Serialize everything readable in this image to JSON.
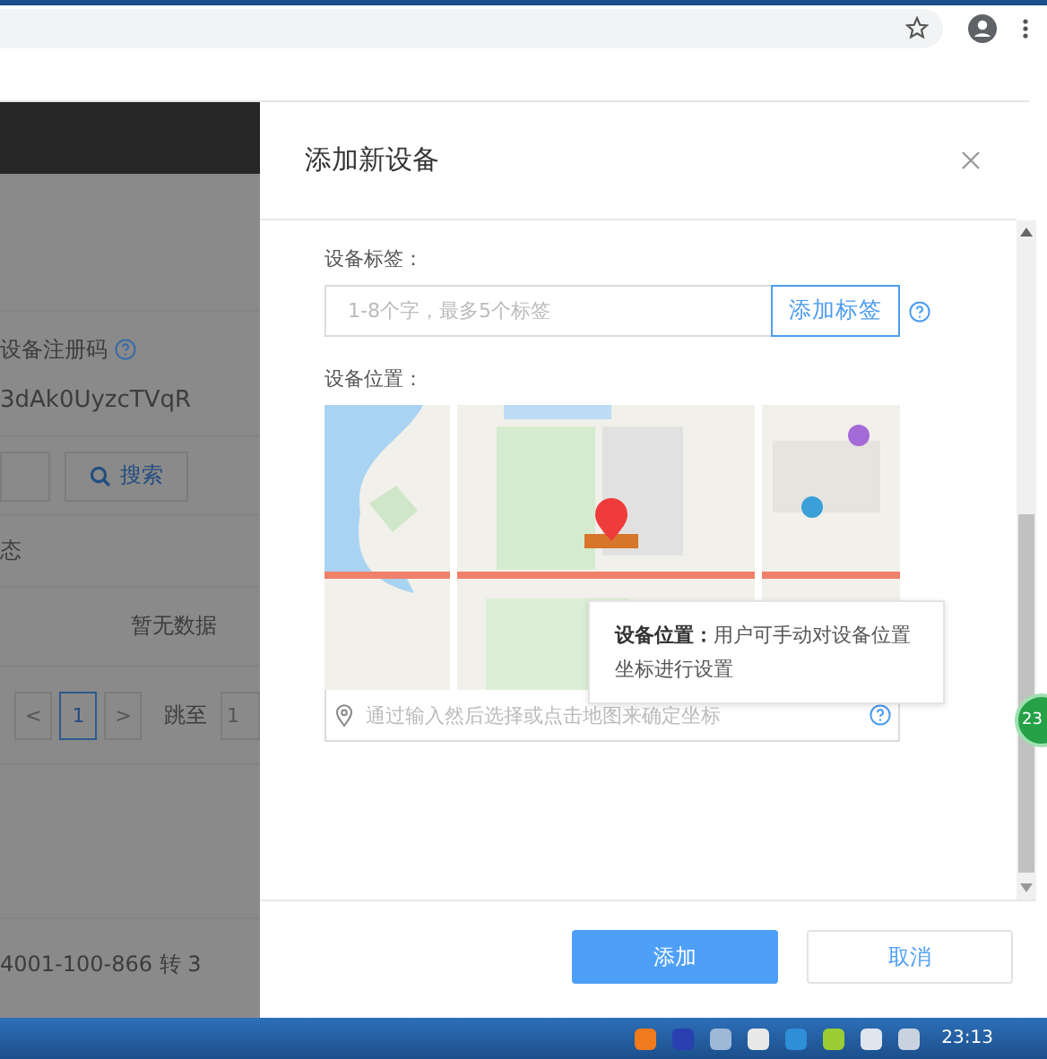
{
  "background_page": {
    "registration_label": "设备注册码",
    "registration_code": "3dAk0UyzcTVqR",
    "search_button": "搜索",
    "column_heading": "态",
    "empty_text": "暂无数据",
    "pagination": {
      "prev": "<",
      "pages": [
        {
          "label": "1",
          "selected": true
        }
      ],
      "next": ">",
      "jump_label": "跳至",
      "jump_value": "1"
    },
    "footer_text": "4001-100-866 转 3"
  },
  "dialog": {
    "title": "添加新设备",
    "fields": [
      {
        "kind": "tags",
        "label": "设备标签：",
        "placeholder": "1-8个字，最多5个标签",
        "button": "添加标签"
      },
      {
        "kind": "location",
        "label": "设备位置：",
        "placeholder": "通过输入然后选择或点击地图来确定坐标"
      }
    ],
    "popover": {
      "text": "**设备位置：**用户可手动对设备位置坐标进行设置"
    },
    "buttons": [
      {
        "label": "添加",
        "primary": true
      },
      {
        "label": "取消",
        "primary": false
      }
    ]
  },
  "floating_badge": "23",
  "taskbar": {
    "clock": "23:13"
  }
}
